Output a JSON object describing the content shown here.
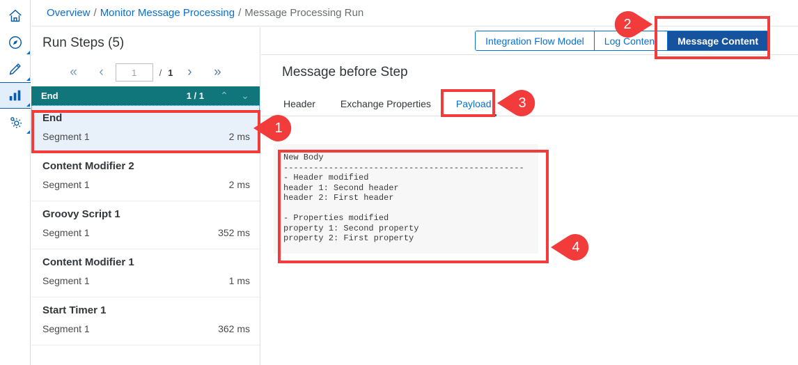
{
  "rail": {
    "items": [
      {
        "name": "home-icon",
        "label": "Home",
        "selected": false,
        "corner": false
      },
      {
        "name": "discover-icon",
        "label": "Discover",
        "selected": false,
        "corner": true
      },
      {
        "name": "design-icon",
        "label": "Design",
        "selected": false,
        "corner": true
      },
      {
        "name": "monitor-icon",
        "label": "Monitor",
        "selected": true,
        "corner": true
      },
      {
        "name": "settings-icon",
        "label": "Settings",
        "selected": false,
        "corner": true
      }
    ]
  },
  "breadcrumb": {
    "items": [
      {
        "label": "Overview",
        "link": true
      },
      {
        "label": "Monitor Message Processing",
        "link": true
      },
      {
        "label": "Message Processing Run",
        "link": false
      }
    ],
    "separator": "/"
  },
  "left_panel": {
    "title": "Run Steps (5)",
    "pager": {
      "first_icon": "«",
      "prev_icon": "‹",
      "page_value": "1",
      "separator": "/",
      "total_pages": "1",
      "next_icon": "›",
      "last_icon": "»"
    },
    "group_header": {
      "name": "End",
      "count": "1 / 1",
      "up_icon": "⌃",
      "down_icon": "⌄"
    },
    "steps": [
      {
        "name": "End",
        "segment": "Segment 1",
        "duration": "2 ms",
        "selected": true
      },
      {
        "name": "Content Modifier 2",
        "segment": "Segment 1",
        "duration": "2 ms",
        "selected": false
      },
      {
        "name": "Groovy Script 1",
        "segment": "Segment 1",
        "duration": "352 ms",
        "selected": false
      },
      {
        "name": "Content Modifier 1",
        "segment": "Segment 1",
        "duration": "1 ms",
        "selected": false
      },
      {
        "name": "Start Timer 1",
        "segment": "Segment 1",
        "duration": "362 ms",
        "selected": false
      }
    ]
  },
  "right_panel": {
    "segmented_tabs": [
      {
        "label": "Integration Flow Model",
        "active": false
      },
      {
        "label": "Log Content",
        "active": false
      },
      {
        "label": "Message Content",
        "active": true
      }
    ],
    "section_title": "Message before Step",
    "inner_tabs": [
      {
        "label": "Header",
        "active": false
      },
      {
        "label": "Exchange Properties",
        "active": false
      },
      {
        "label": "Payload",
        "active": true
      }
    ],
    "payload_text": "New Body\n------------------------------------------------\n- Header modified\nheader 1: Second header\nheader 2: First header\n\n- Properties modified\nproperty 1: Second property\nproperty 2: First property"
  },
  "annotations": {
    "callouts": [
      {
        "number": "1",
        "direction": "left",
        "target": "selected-run-step"
      },
      {
        "number": "2",
        "direction": "right",
        "target": "message-content-tab"
      },
      {
        "number": "3",
        "direction": "left",
        "target": "payload-tab"
      },
      {
        "number": "4",
        "direction": "left",
        "target": "payload-body"
      }
    ],
    "highlight_color": "#f23b3b"
  },
  "colors": {
    "accent_blue": "#0a6ed1",
    "active_tab_blue": "#15539e",
    "group_header_teal": "#11757c",
    "selected_row_bg": "#e8f0f9",
    "annotation_red": "#f23b3b"
  }
}
